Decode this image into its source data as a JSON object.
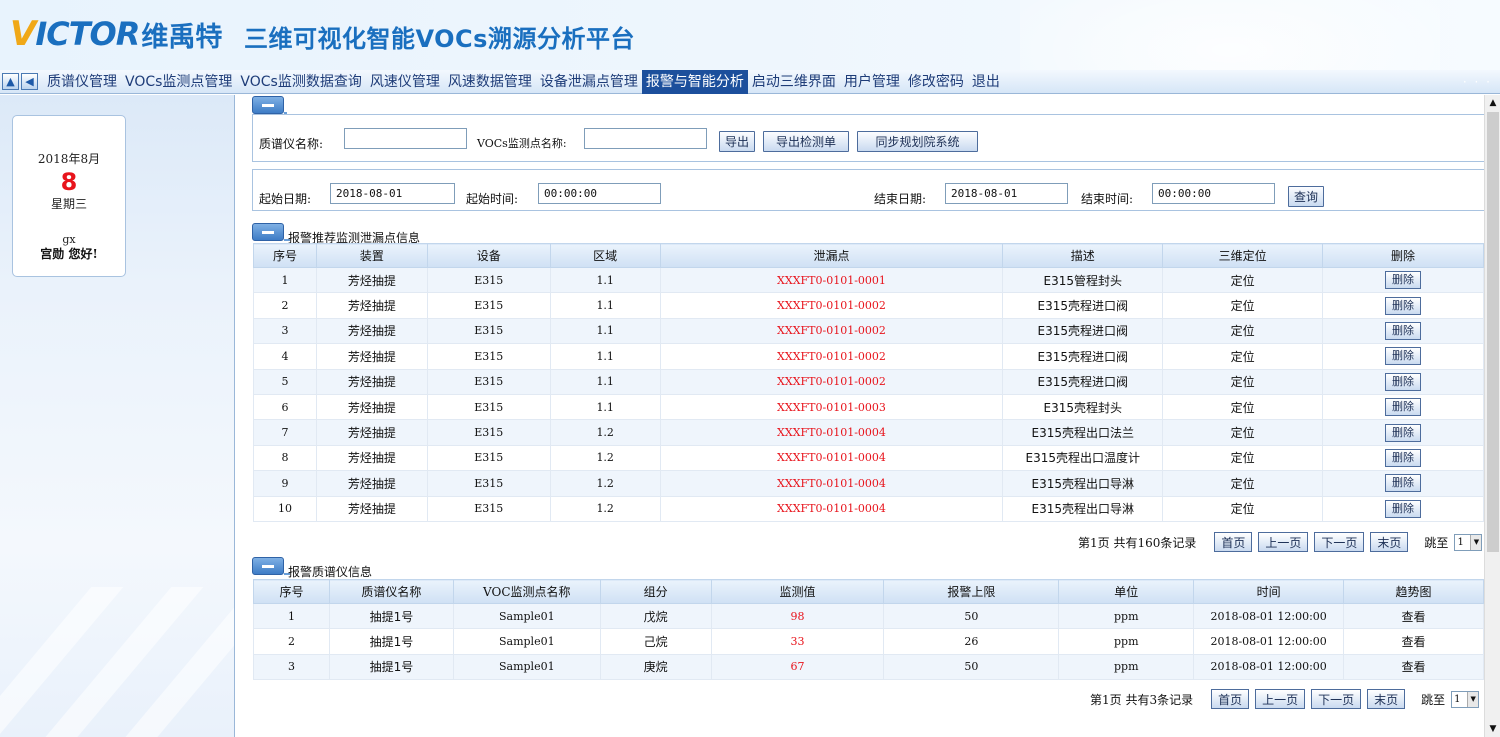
{
  "header": {
    "logo_v": "V",
    "logo_rest": "ICTOR",
    "logo_cn": "维禹特",
    "title": "三维可视化智能VOCs溯源分析平台"
  },
  "nav": {
    "up_icon": "arrow-up-icon",
    "back_icon": "arrow-left-icon",
    "items": [
      {
        "label": "质谱仪管理"
      },
      {
        "label": "VOCs监测点管理"
      },
      {
        "label": "VOCs监测数据查询"
      },
      {
        "label": "风速仪管理"
      },
      {
        "label": "风速数据管理"
      },
      {
        "label": "设备泄漏点管理"
      },
      {
        "label": "报警与智能分析",
        "active": true
      },
      {
        "label": "启动三维界面"
      },
      {
        "label": "用户管理"
      },
      {
        "label": "修改密码"
      },
      {
        "label": "退出"
      }
    ],
    "dots": "· · ·"
  },
  "sidebar": {
    "year_month": "2018年8月",
    "day": "8",
    "weekday": "星期三",
    "user": "gx",
    "greeting": "宫勋 您好!"
  },
  "filter1": {
    "ms_label": "质谱仪名称:",
    "ms_value": "",
    "point_label": "VOCs监测点名称:",
    "point_value": "",
    "export": "导出",
    "export_sheet": "导出检测单",
    "sync": "同步规划院系统"
  },
  "filter2": {
    "start_date_label": "起始日期:",
    "start_date": "2018-08-01",
    "start_time_label": "起始时间:",
    "start_time": "00:00:00",
    "end_date_label": "结束日期:",
    "end_date": "2018-08-01",
    "end_time_label": "结束时间:",
    "end_time": "00:00:00",
    "query": "查询"
  },
  "leak_section": {
    "title": "报警推荐监测泄漏点信息",
    "headers": [
      "序号",
      "装置",
      "设备",
      "区域",
      "泄漏点",
      "描述",
      "三维定位",
      "删除"
    ],
    "rows": [
      [
        "1",
        "芳烃抽提",
        "E315",
        "1.1",
        "XXXFT0-0101-0001",
        "E315管程封头",
        "定位",
        "删除"
      ],
      [
        "2",
        "芳烃抽提",
        "E315",
        "1.1",
        "XXXFT0-0101-0002",
        "E315壳程进口阀",
        "定位",
        "删除"
      ],
      [
        "3",
        "芳烃抽提",
        "E315",
        "1.1",
        "XXXFT0-0101-0002",
        "E315壳程进口阀",
        "定位",
        "删除"
      ],
      [
        "4",
        "芳烃抽提",
        "E315",
        "1.1",
        "XXXFT0-0101-0002",
        "E315壳程进口阀",
        "定位",
        "删除"
      ],
      [
        "5",
        "芳烃抽提",
        "E315",
        "1.1",
        "XXXFT0-0101-0002",
        "E315壳程进口阀",
        "定位",
        "删除"
      ],
      [
        "6",
        "芳烃抽提",
        "E315",
        "1.1",
        "XXXFT0-0101-0003",
        "E315壳程封头",
        "定位",
        "删除"
      ],
      [
        "7",
        "芳烃抽提",
        "E315",
        "1.2",
        "XXXFT0-0101-0004",
        "E315壳程出口法兰",
        "定位",
        "删除"
      ],
      [
        "8",
        "芳烃抽提",
        "E315",
        "1.2",
        "XXXFT0-0101-0004",
        "E315壳程出口温度计",
        "定位",
        "删除"
      ],
      [
        "9",
        "芳烃抽提",
        "E315",
        "1.2",
        "XXXFT0-0101-0004",
        "E315壳程出口导淋",
        "定位",
        "删除"
      ],
      [
        "10",
        "芳烃抽提",
        "E315",
        "1.2",
        "XXXFT0-0101-0004",
        "E315壳程出口导淋",
        "定位",
        "删除"
      ]
    ],
    "pager": {
      "info": "第1页 共有160条记录",
      "first": "首页",
      "prev": "上一页",
      "next": "下一页",
      "last": "末页",
      "jump": "跳至",
      "page": "1"
    }
  },
  "ms_section": {
    "title": "报警质谱仪信息",
    "headers": [
      "序号",
      "质谱仪名称",
      "VOC监测点名称",
      "组分",
      "监测值",
      "报警上限",
      "单位",
      "时间",
      "趋势图"
    ],
    "rows": [
      [
        "1",
        "抽提1号",
        "Sample01",
        "戊烷",
        "98",
        "50",
        "ppm",
        "2018-08-01 12:00:00",
        "查看"
      ],
      [
        "2",
        "抽提1号",
        "Sample01",
        "己烷",
        "33",
        "26",
        "ppm",
        "2018-08-01 12:00:00",
        "查看"
      ],
      [
        "3",
        "抽提1号",
        "Sample01",
        "庚烷",
        "67",
        "50",
        "ppm",
        "2018-08-01 12:00:00",
        "查看"
      ]
    ],
    "pager": {
      "info": "第1页 共有3条记录",
      "first": "首页",
      "prev": "上一页",
      "next": "下一页",
      "last": "末页",
      "jump": "跳至",
      "page": "1"
    }
  },
  "colors": {
    "brand_blue": "#1a6fbf",
    "logo_orange": "#f0a818",
    "nav_active": "#1c4f9c",
    "alert_red": "#e8141c"
  }
}
